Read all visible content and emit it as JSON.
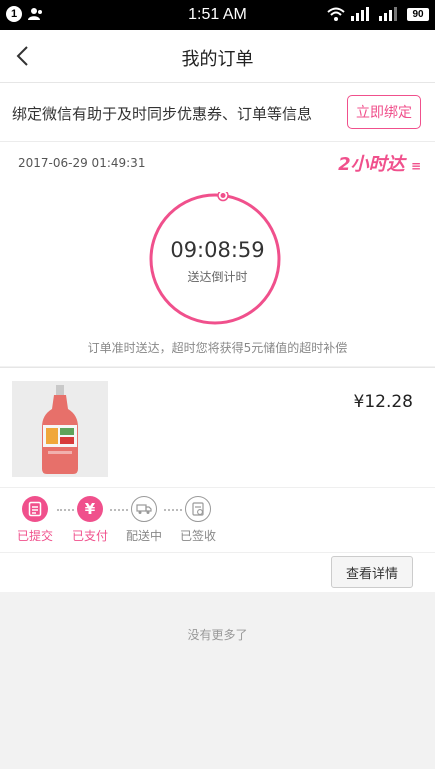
{
  "status_bar": {
    "notification_count": "1",
    "time": "1:51 AM",
    "battery": "90"
  },
  "nav": {
    "title": "我的订单"
  },
  "bind_banner": {
    "text": "绑定微信有助于及时同步优惠券、订单等信息",
    "button_label": "立即绑定"
  },
  "order": {
    "timestamp": "2017-06-29 01:49:31",
    "delivery_tag": "2小时达",
    "countdown_time": "09:08:59",
    "countdown_label": "送达倒计时",
    "guarantee_text": "订单准时送达，超时您将获得5元储值的超时补偿",
    "countdown_progress": 0.02
  },
  "product": {
    "price": "¥12.28"
  },
  "progress_steps": [
    {
      "label": "已提交",
      "icon": "document-icon",
      "done": true
    },
    {
      "label": "已支付",
      "icon": "yen-icon",
      "done": true
    },
    {
      "label": "配送中",
      "icon": "delivery-truck-icon",
      "done": false
    },
    {
      "label": "已签收",
      "icon": "receipt-check-icon",
      "done": false
    }
  ],
  "actions": {
    "view_details": "查看详情"
  },
  "footer": {
    "no_more": "没有更多了"
  },
  "colors": {
    "accent": "#f0508c",
    "background": "#f2f2f2",
    "status_bar": "#000000"
  }
}
